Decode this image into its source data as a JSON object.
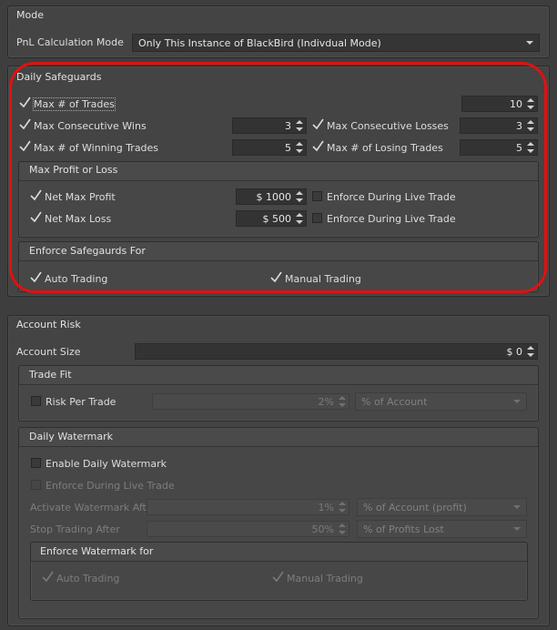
{
  "mode": {
    "title": "Mode",
    "pnl_label": "PnL Calculation Mode",
    "pnl_value": "Only This Instance of BlackBird (Indivdual Mode)"
  },
  "daily": {
    "title": "Daily Safeguards",
    "max_trades_label": "Max # of Trades",
    "max_trades_value": "10",
    "max_cons_wins_label": "Max Consecutive Wins",
    "max_cons_wins_value": "3",
    "max_cons_losses_label": "Max Consecutive Losses",
    "max_cons_losses_value": "3",
    "max_winning_label": "Max # of Winning Trades",
    "max_winning_value": "5",
    "max_losing_label": "Max # of Losing Trades",
    "max_losing_value": "5",
    "profit_loss": {
      "title": "Max Profit or Loss",
      "net_profit_label": "Net Max Profit",
      "net_profit_value": "$ 1000",
      "enforce1_label": "Enforce During Live Trade",
      "net_loss_label": "Net Max Loss",
      "net_loss_value": "$ 500",
      "enforce2_label": "Enforce During Live Trade"
    },
    "enforce_for": {
      "title": "Enforce Safegaurds For",
      "auto_label": "Auto Trading",
      "manual_label": "Manual Trading"
    }
  },
  "account": {
    "title": "Account Risk",
    "size_label": "Account Size",
    "size_value": "$ 0",
    "trade_fit": {
      "title": "Trade Fit",
      "risk_label": "Risk Per Trade",
      "risk_value": "2%",
      "risk_unit": "% of Account"
    },
    "watermark": {
      "title": "Daily Watermark",
      "enable_label": "Enable Daily Watermark",
      "enforce_label": "Enforce During Live Trade",
      "activate_label": "Activate Watermark After",
      "activate_value": "1%",
      "activate_unit": "% of Account (profit)",
      "stop_label": "Stop Trading After",
      "stop_value": "50%",
      "stop_unit": "% of Profits Lost",
      "enforce_for": {
        "title": "Enforce Watermark for",
        "auto_label": "Auto Trading",
        "manual_label": "Manual Trading"
      }
    }
  },
  "colors": {
    "highlight": "#e21010",
    "panel": "#444444",
    "field": "#333333"
  }
}
